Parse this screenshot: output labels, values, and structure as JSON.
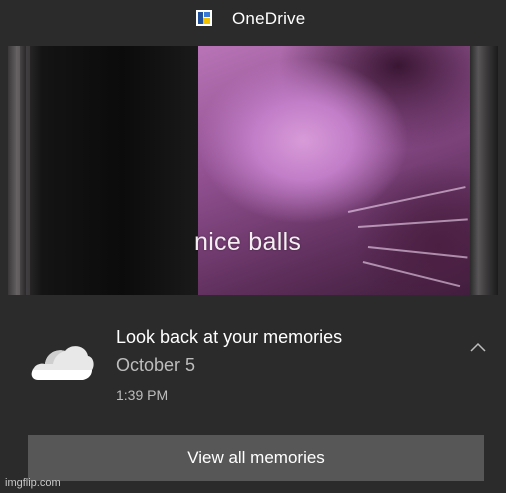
{
  "header": {
    "app_name": "OneDrive",
    "icon": "onedrive-app-icon"
  },
  "hero": {
    "caption": "nice balls"
  },
  "notification": {
    "icon": "onedrive-cloud-icon",
    "title": "Look back at your memories",
    "date": "October 5",
    "time": "1:39 PM",
    "collapse_icon": "chevron-up-icon"
  },
  "actions": {
    "view_all_label": "View all memories"
  },
  "watermark": "imgflip.com",
  "colors": {
    "background": "#2b2b2b",
    "button": "#575757",
    "secondary_text": "#bdbdbd"
  }
}
